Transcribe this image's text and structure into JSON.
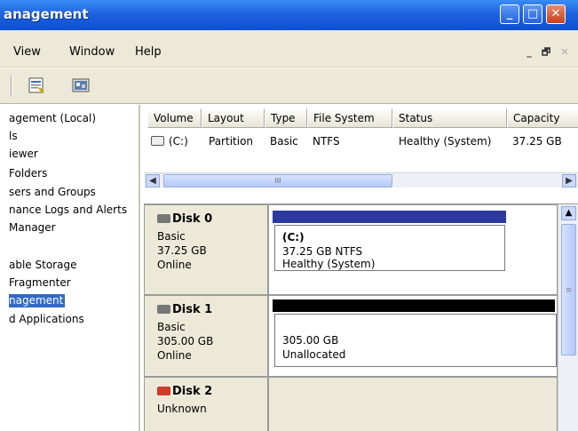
{
  "window": {
    "title": "anagement",
    "caption_buttons": {
      "minimize": "_",
      "maximize": "□",
      "close": "✕"
    }
  },
  "menu": {
    "items": [
      "View",
      "Window",
      "Help"
    ],
    "mdi": {
      "minimize": "_",
      "restore": "🗗",
      "close": "✕"
    }
  },
  "toolbar": {
    "icons": [
      "properties-icon",
      "help-icon"
    ]
  },
  "tree": {
    "items": [
      "agement (Local)",
      "ls",
      "iewer",
      "Folders",
      "sers and Groups",
      "nance Logs and Alerts",
      "Manager",
      "able Storage",
      "Fragmenter",
      "nagement",
      "d Applications"
    ],
    "selected_index": 9
  },
  "volumes": {
    "columns": [
      "Volume",
      "Layout",
      "Type",
      "File System",
      "Status",
      "Capacity"
    ],
    "rows": [
      {
        "volume": "(C:)",
        "layout": "Partition",
        "type": "Basic",
        "file_system": "NTFS",
        "status": "Healthy (System)",
        "capacity": "37.25 GB"
      }
    ],
    "hscroll_grip": "III"
  },
  "disks": [
    {
      "name": "Disk 0",
      "type": "Basic",
      "size": "37.25 GB",
      "state": "Online",
      "bar_color": "#2c3aa0",
      "partition": {
        "label": "(C:)",
        "detail": "37.25 GB NTFS",
        "status": "Healthy (System)"
      }
    },
    {
      "name": "Disk 1",
      "type": "Basic",
      "size": "305.00 GB",
      "state": "Online",
      "bar_color": "#000000",
      "partition": {
        "label": "",
        "detail": "305.00 GB",
        "status": "Unallocated"
      }
    },
    {
      "name": "Disk 2",
      "type": "Unknown"
    }
  ],
  "colors": {
    "titlebar": "#1f63e0",
    "selection": "#316ac5",
    "chrome": "#ece9d8"
  }
}
